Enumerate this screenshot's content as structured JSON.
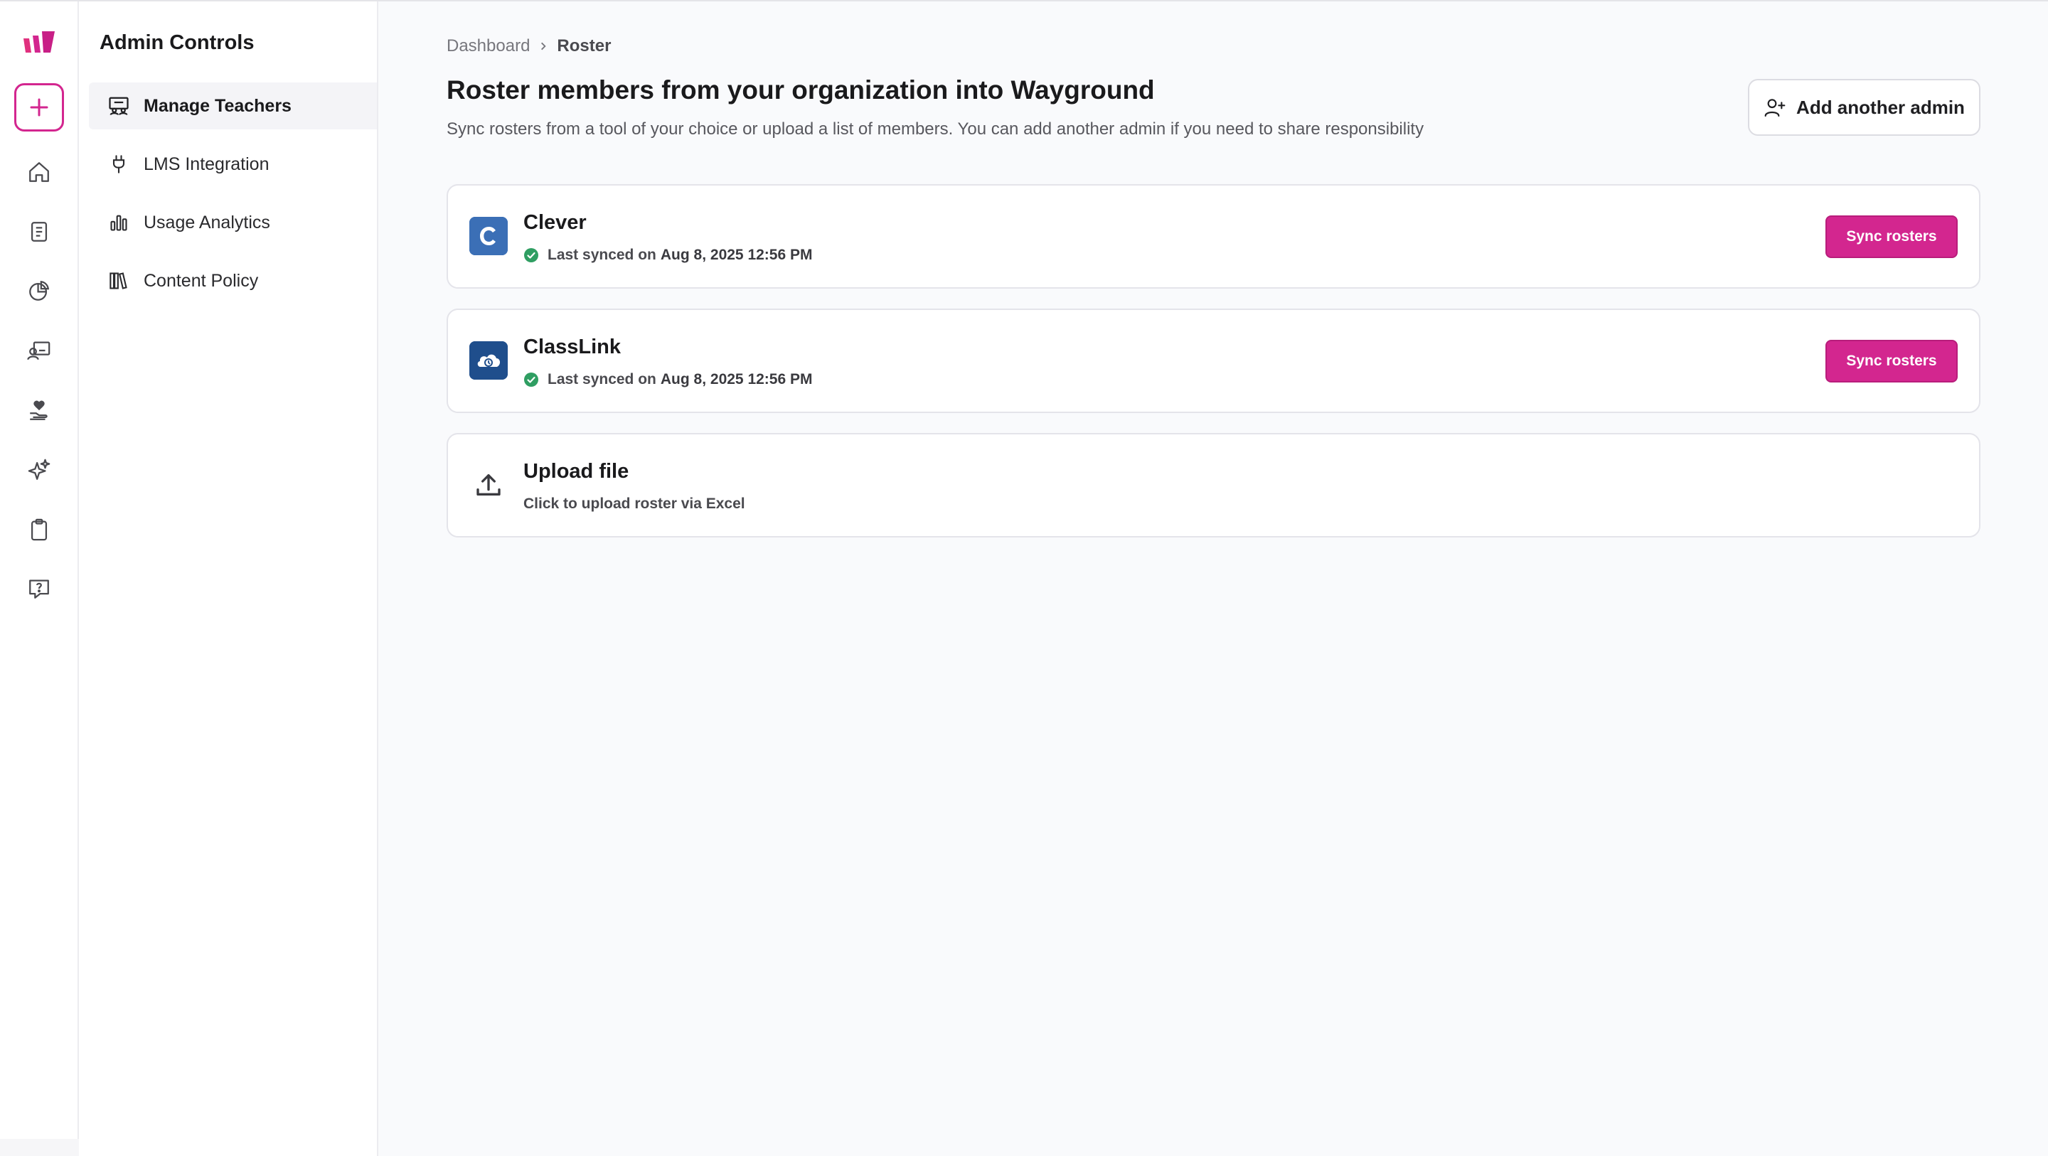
{
  "rail": {
    "icons": [
      "wayground-logo-icon",
      "plus-icon",
      "home-icon",
      "library-icon",
      "reports-icon",
      "classes-icon",
      "heart-hand-icon",
      "sparkles-icon",
      "clipboard-icon",
      "help-icon"
    ],
    "accent": "#d3268f"
  },
  "sidebar": {
    "title": "Admin Controls",
    "items": [
      {
        "label": "Manage Teachers",
        "icon": "users-board-icon",
        "active": true
      },
      {
        "label": "LMS Integration",
        "icon": "plug-icon",
        "active": false
      },
      {
        "label": "Usage Analytics",
        "icon": "bar-chart-icon",
        "active": false
      },
      {
        "label": "Content Policy",
        "icon": "books-icon",
        "active": false
      }
    ]
  },
  "breadcrumb": {
    "parent": "Dashboard",
    "current": "Roster"
  },
  "header": {
    "title": "Roster members from your organization into Wayground",
    "subtitle": "Sync rosters from a tool of your choice or upload a list of members. You can add another admin if you need to share responsibility",
    "add_admin_label": "Add another admin"
  },
  "cards": [
    {
      "name": "Clever",
      "status_prefix": "Last synced on",
      "status_date": "Aug 8, 2025 12:56 PM",
      "action": "Sync rosters",
      "logo": "clever-logo-icon",
      "logo_color": "#3b6fb6"
    },
    {
      "name": "ClassLink",
      "status_prefix": "Last synced on",
      "status_date": "Aug 8, 2025 12:56 PM",
      "action": "Sync rosters",
      "logo": "classlink-logo-icon",
      "logo_color": "#1f4e8c"
    },
    {
      "name": "Upload file",
      "description": "Click to upload roster via Excel",
      "logo": "upload-icon"
    }
  ],
  "colors": {
    "primary": "#d3268f",
    "success": "#2f9e62"
  }
}
